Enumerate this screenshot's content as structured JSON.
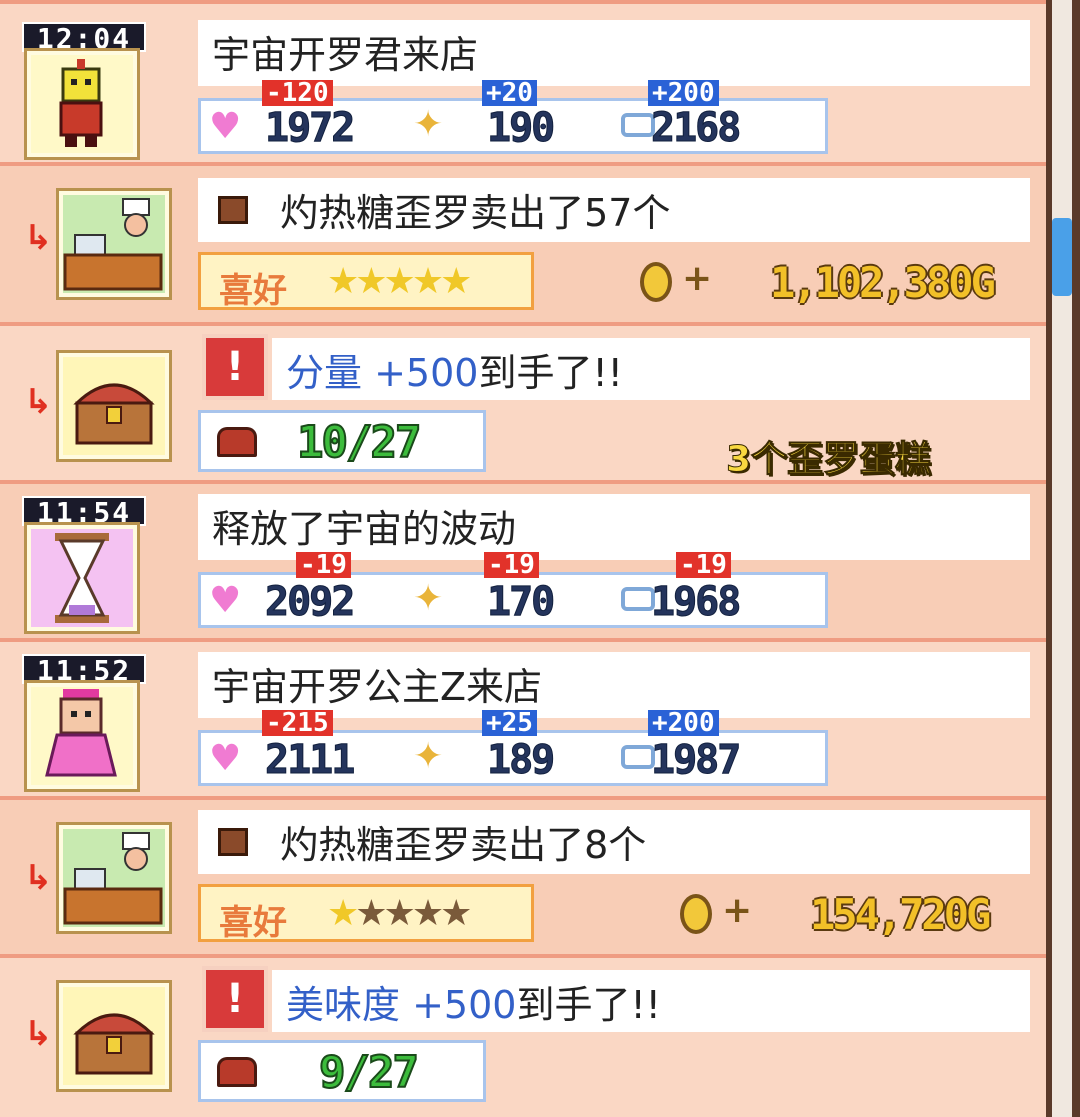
{
  "log": {
    "entries": [
      {
        "time": "12:04",
        "message": "宇宙开罗君来店",
        "stats": {
          "heart": {
            "value": "1972",
            "delta": "-120"
          },
          "star": {
            "value": "190",
            "delta": "+20"
          },
          "bubble": {
            "value": "2168",
            "delta": "+200"
          }
        }
      },
      {
        "message": "灼热糖歪罗卖出了57个",
        "preference_label": "喜好",
        "stars_filled": 5,
        "stars_total": 5,
        "money": "1,102,380G"
      },
      {
        "badge": "!",
        "message_stat": "分量 +500",
        "message_suffix": "到手了!!",
        "progress": "10/27"
      },
      {
        "time": "11:54",
        "message": "释放了宇宙的波动",
        "stats": {
          "heart": {
            "value": "2092",
            "delta": "-19"
          },
          "star": {
            "value": "170",
            "delta": "-19"
          },
          "bubble": {
            "value": "1968",
            "delta": "-19"
          }
        }
      },
      {
        "time": "11:52",
        "message": "宇宙开罗公主Z来店",
        "stats": {
          "heart": {
            "value": "2111",
            "delta": "-215"
          },
          "star": {
            "value": "189",
            "delta": "+25"
          },
          "bubble": {
            "value": "1987",
            "delta": "+200"
          }
        }
      },
      {
        "message": "灼热糖歪罗卖出了8个",
        "preference_label": "喜好",
        "stars_filled": 1,
        "stars_total": 5,
        "money": "154,720G"
      },
      {
        "badge": "!",
        "message_stat": "美味度 +500",
        "message_suffix": "到手了!!",
        "progress": "9/27"
      }
    ]
  },
  "overlay_caption": "3个歪罗蛋糕",
  "icons": [
    "robot-customer-icon",
    "chef-counter-icon",
    "treasure-chest-icon",
    "hourglass-icon",
    "princess-customer-icon",
    "heart-icon",
    "sparkle-icon",
    "speech-bubble-icon",
    "coin-icon",
    "bag-icon"
  ],
  "colors": {
    "negative_delta": "#e2322a",
    "positive_delta": "#2a62d6",
    "scroll_thumb": "#4aa0e8"
  }
}
